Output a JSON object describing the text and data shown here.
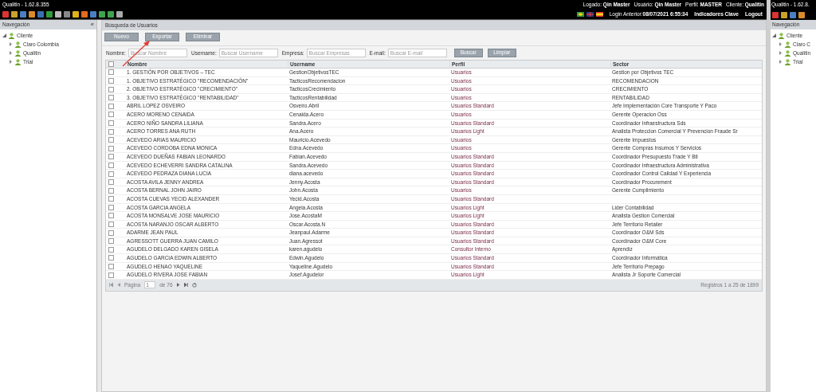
{
  "window": {
    "title": "Qualitin - 1.62.8.355",
    "session": [
      "Logado: **Qin Master**",
      "Usuário: **Qin Master**",
      "Perfil: **MASTER**",
      "Cliente: **Qualitin**"
    ],
    "login_previous": "Login Anterior:**08/07/2021 6:55:34**",
    "top_links": [
      "Indicadores Clave",
      "Logout"
    ]
  },
  "sidebar": {
    "title": "Navegación",
    "collapse": "«",
    "tree": [
      {
        "label": "Cliente",
        "expanded": true,
        "children": [
          {
            "label": "Claro Colombia",
            "expanded": false
          },
          {
            "label": "Qualitin",
            "expanded": false
          },
          {
            "label": "Trial",
            "expanded": false
          }
        ]
      }
    ]
  },
  "panel": {
    "title": "Búsqueda de Usuarios",
    "buttons": [
      "Nuevo",
      "Exportar",
      "Eliminar"
    ],
    "filters": [
      {
        "label": "Nombre:",
        "placeholder": "Buscar Nombre"
      },
      {
        "label": "Username:",
        "placeholder": "Buscar Username"
      },
      {
        "label": "Empresa:",
        "placeholder": "Buscar Empresas"
      },
      {
        "label": "E-mail:",
        "placeholder": "Buscar E-mail"
      }
    ],
    "filter_buttons": [
      "Buscar",
      "Limpiar"
    ]
  },
  "table": {
    "header_checked": false,
    "columns": [
      "Nombre",
      "Username",
      "Perfil",
      "Sector"
    ],
    "rows": [
      {
        "checked": false,
        "cells": [
          "1. GESTIÓN POR OBJETIVOS – TEC",
          "GestionObjetivosTEC",
          "Usuarios",
          "Gestion por Objetivos TEC"
        ]
      },
      {
        "checked": false,
        "cells": [
          "1. OBJETIVO ESTRATÉGICO \"RECOMENDACIÓN\"",
          "TacticosRecomendacion",
          "Usuarios",
          "RECOMENDACION"
        ]
      },
      {
        "checked": false,
        "cells": [
          "2. OBJETIVO ESTRATÉGICO \"CRECIMIENTO\"",
          "TacticosCrecimiento",
          "Usuarios",
          "CRECIMIENTO"
        ]
      },
      {
        "checked": false,
        "cells": [
          "3. OBJETIVO ESTRATÉGICO \"RENTABILIDAD\"",
          "TacticosRentabilidad",
          "Usuarios",
          "RENTABILIDAD"
        ]
      },
      {
        "checked": false,
        "cells": [
          "ABRIL LOPEZ OSVEIRO",
          "Osveiro.Abril",
          "Usuarios Standard",
          "Jefe Implementación Core Transporte Y Paco"
        ]
      },
      {
        "checked": false,
        "cells": [
          "ACERO MORENO CENAIDA",
          "Cenaida.Acero",
          "Usuarios",
          "Gerente Operacion Oss"
        ]
      },
      {
        "checked": false,
        "cells": [
          "ACERO NIÑO SANDRA LILIANA",
          "Sandra.Acero",
          "Usuarios Standard",
          "Coordinador Infraestructura Sds"
        ]
      },
      {
        "checked": false,
        "cells": [
          "ACERO TORRES ANA RUTH",
          "Ana.Acero",
          "Usuarios Light",
          "Analista Proteccion Comercial Y Prevencion Fraude Sr"
        ]
      },
      {
        "checked": false,
        "cells": [
          "ACEVEDO ARIAS MAURICIO",
          "Mauricio.Acevedo",
          "Usuarios",
          "Gerente Impuestos"
        ]
      },
      {
        "checked": false,
        "cells": [
          "ACEVEDO CORDOBA EDNA MONICA",
          "Edna.Acevedo",
          "Usuarios",
          "Gerente Compras Insumos Y Servicios"
        ]
      },
      {
        "checked": false,
        "cells": [
          "ACEVEDO DUEÑAS FABIAN LEONARDO",
          "Fabian.Acevedo",
          "Usuarios Standard",
          "Coordinador Presupuesto Trade Y Btl"
        ]
      },
      {
        "checked": false,
        "cells": [
          "ACEVEDO ECHEVERRI SANDRA CATALINA",
          "Sandra.Acevedo",
          "Usuarios Standard",
          "Coordinador Infraestructura Administrativa"
        ]
      },
      {
        "checked": false,
        "cells": [
          "ACEVEDO PEDRAZA DIANA LUCIA",
          "diana.acevedo",
          "Usuarios Standard",
          "Coordinador Control Calidad Y Experiencia"
        ]
      },
      {
        "checked": false,
        "cells": [
          "ACOSTA AVILA JENNY ANDREA",
          "Jenny.Acosta",
          "Usuarios Standard",
          "Coordinador Procurement"
        ]
      },
      {
        "checked": false,
        "cells": [
          "ACOSTA BERNAL JOHN JAIRO",
          "John.Acosta",
          "Usuarios",
          "Gerente Cumplimiento"
        ]
      },
      {
        "checked": false,
        "cells": [
          "ACOSTA CUEVAS YECID ALEXANDER",
          "Yecid.Acosta",
          "Usuarios Standard",
          ""
        ]
      },
      {
        "checked": false,
        "cells": [
          "ACOSTA GARCIA ANGELA",
          "Angela.Acosta",
          "Usuarios Light",
          "Lider Contabilidad"
        ]
      },
      {
        "checked": false,
        "cells": [
          "ACOSTA MONSALVE JOSE MAURICIO",
          "Jose.AcostaM",
          "Usuarios Light",
          "Analista Gestion Comercial"
        ]
      },
      {
        "checked": false,
        "cells": [
          "ACOSTA NARANJO OSCAR ALBERTO",
          "Oscar.Acosta.N",
          "Usuarios Standard",
          "Jefe Territorio Retailer"
        ]
      },
      {
        "checked": false,
        "cells": [
          "ADARME JEAN PAUL",
          "Jeanpaul.Adarme",
          "Usuarios Standard",
          "Coordinador O&M Sds"
        ]
      },
      {
        "checked": false,
        "cells": [
          "AGRESSOTT GUERRA JUAN CAMILO",
          "Juan.Agressot",
          "Usuarios Standard",
          "Coordinador O&M Core"
        ]
      },
      {
        "checked": false,
        "cells": [
          "AGUDELO DELGADO KAREN GISELA",
          "karen.agudelo",
          "Consultor Interno",
          "Aprendiz"
        ]
      },
      {
        "checked": false,
        "cells": [
          "AGUDELO GARCIA EDWIN ALBERTO",
          "Edwin.Agudelo",
          "Usuarios Standard",
          "Coordinador Informática"
        ]
      },
      {
        "checked": false,
        "cells": [
          "AGUDELO HENAO YAQUELINE",
          "Yaqueline.Agudelo",
          "Usuarios Standard",
          "Jefe Territorio Prepago"
        ]
      },
      {
        "checked": false,
        "cells": [
          "AGUDELO RIVERA JOSE FABIAN",
          "Josef.Agudelor",
          "Usuarios Light",
          "Analista Jr Soporte Comercial"
        ]
      }
    ]
  },
  "pager": {
    "page_label": "Página",
    "page": "1",
    "of": "de 76",
    "records": "Registros 1 a 25 de 1899"
  },
  "second_window": {
    "title": "Qualitin - 1.62.8.",
    "sidebar_title": "Navegación",
    "tree": [
      {
        "label": "Cliente",
        "expanded": true,
        "children": [
          {
            "label": "Claro C",
            "expanded": false
          },
          {
            "label": "Qualitin",
            "expanded": false
          },
          {
            "label": "Trial",
            "expanded": false
          }
        ]
      }
    ]
  }
}
